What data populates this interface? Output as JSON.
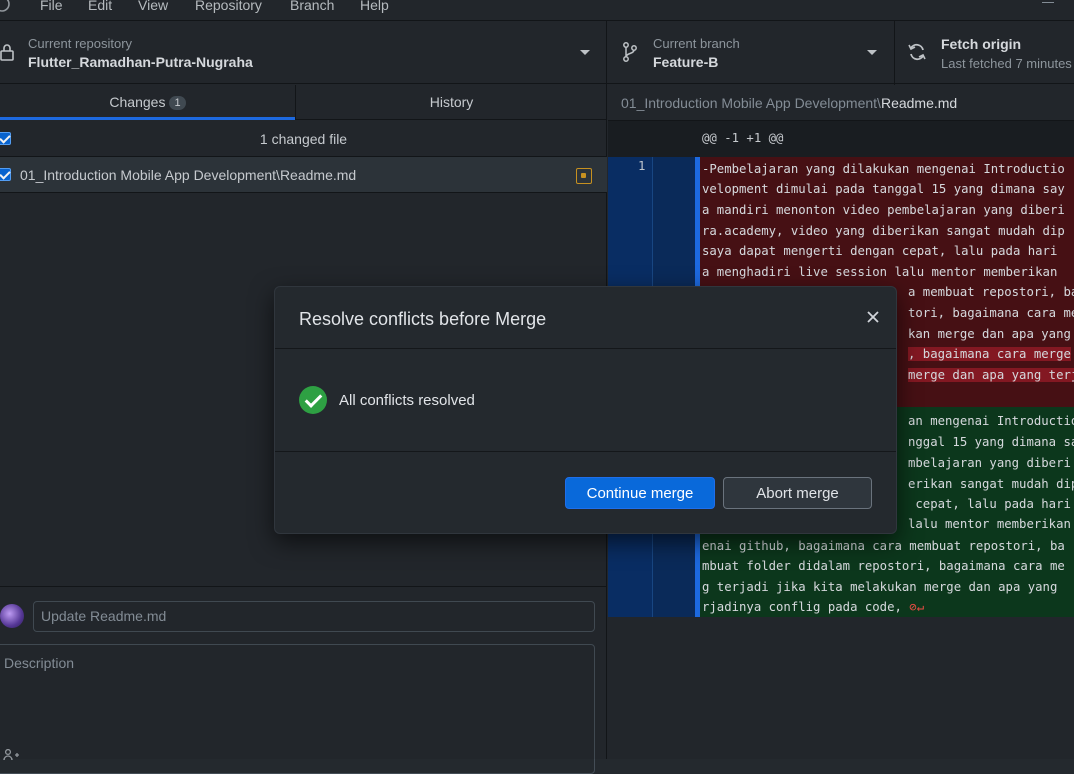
{
  "menu": {
    "items": [
      "File",
      "Edit",
      "View",
      "Repository",
      "Branch",
      "Help"
    ]
  },
  "toolbar": {
    "repo_label": "Current repository",
    "repo_value": "Flutter_Ramadhan-Putra-Nugraha",
    "branch_label": "Current branch",
    "branch_value": "Feature-B",
    "fetch_label": "Fetch origin",
    "fetch_sub": "Last fetched 7 minutes"
  },
  "tabs": {
    "changes_label": "Changes",
    "changes_count": "1",
    "history_label": "History"
  },
  "changes": {
    "header": "1 changed file",
    "file": "01_Introduction Mobile App Development\\Readme.md"
  },
  "commit": {
    "summary_placeholder": "Update Readme.md",
    "description_placeholder": "Description"
  },
  "diff": {
    "path_prefix": "01_Introduction Mobile App Development\\",
    "path_file": "Readme.md",
    "hunk": "@@ -1 +1 @@",
    "line_number": "1",
    "deleted_lines": [
      "-Pembelajaran yang dilakukan mengenai Introductio",
      "velopment dimulai pada tanggal 15 yang dimana say",
      "a mandiri menonton video pembelajaran yang diberi",
      "ra.academy, video yang diberikan sangat mudah dip",
      "saya dapat mengerti dengan cepat, lalu pada hari",
      "a menghadiri live session lalu mentor memberikan",
      "a membuat repostori, ba",
      "tori, bagaimana cara me",
      "kan merge dan apa yang",
      ", bagaimana cara merge",
      "merge dan apa yang terj"
    ],
    "added_lines": [
      "an mengenai Introductio",
      "nggal 15 yang dimana say",
      "mbelajaran yang diberi",
      "erikan sangat mudah dip",
      " cepat, lalu pada hari",
      "lalu mentor memberikan",
      "enai github, bagaimana cara membuat repostori, ba",
      "mbuat folder didalam repostori, bagaimana cara me",
      "g terjadi jika kita melakukan merge dan apa yang",
      "rjadinya conflig pada code, "
    ],
    "nl_marker": "⊘↵"
  },
  "modal": {
    "title": "Resolve conflicts before Merge",
    "status": "All conflicts resolved",
    "continue_label": "Continue merge",
    "abort_label": "Abort merge"
  }
}
